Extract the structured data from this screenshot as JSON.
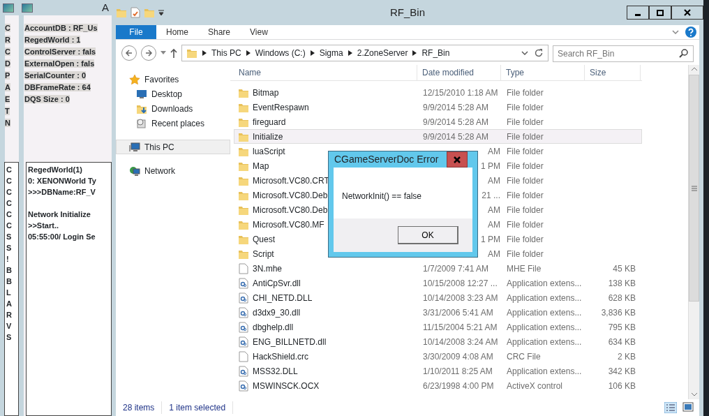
{
  "background_windows": [
    {
      "status_lines": [
        "C",
        "R",
        "C",
        "D",
        "P",
        "A",
        "E",
        "T",
        "N"
      ],
      "log_blocks": [
        [
          "C",
          "C",
          "C",
          "C",
          "C",
          "C",
          "S",
          "S",
          "!",
          "B",
          "B",
          "L",
          "A",
          "R",
          "V",
          "S"
        ]
      ]
    },
    {
      "title": "A",
      "status_lines": [
        "AccountDB : RF_Us",
        "RegedWorld : 1",
        "ControlServer : fals",
        "ExternalOpen : fals",
        "SerialCounter : 0",
        "DBFrameRate : 64",
        "DQS Size : 0"
      ],
      "log_blocks": [
        [
          "RegedWorld(1)",
          "0: XENONWorld Ty",
          ">>>DBName:RF_V"
        ],
        [
          "Network Initialize",
          ">>Start..",
          "05:55:00/ Login Se"
        ]
      ]
    }
  ],
  "explorer": {
    "title": "RF_Bin",
    "ribbon_tabs": [
      {
        "label": "File",
        "selected": true
      },
      {
        "label": "Home",
        "selected": false
      },
      {
        "label": "Share",
        "selected": false
      },
      {
        "label": "View",
        "selected": false
      }
    ],
    "breadcrumbs": [
      "This PC",
      "Windows (C:)",
      "Sigma",
      "2.ZoneServer",
      "RF_Bin"
    ],
    "search": {
      "placeholder": "Search RF_Bin"
    },
    "nav_items": [
      {
        "label": "Favorites",
        "kind": "favorites",
        "selected": false,
        "children": [
          {
            "label": "Desktop",
            "kind": "desktop",
            "selected": false
          },
          {
            "label": "Downloads",
            "kind": "downloads",
            "selected": false
          },
          {
            "label": "Recent places",
            "kind": "recent",
            "selected": false
          }
        ]
      },
      {
        "label": "This PC",
        "kind": "pc",
        "selected": true
      },
      {
        "label": "Network",
        "kind": "network",
        "selected": false
      }
    ],
    "columns": [
      "Name",
      "Date modified",
      "Type",
      "Size"
    ],
    "rows": [
      {
        "name": "Bitmap",
        "date": "12/15/2010 1:18 AM",
        "type": "File folder",
        "kind": "folder",
        "selected": false
      },
      {
        "name": "EventRespawn",
        "date": "9/9/2014 5:28 AM",
        "type": "File folder",
        "kind": "folder",
        "selected": false
      },
      {
        "name": "fireguard",
        "date": "9/9/2014 5:28 AM",
        "type": "File folder",
        "kind": "folder",
        "selected": false
      },
      {
        "name": "Initialize",
        "date": "9/9/2014 5:28 AM",
        "type": "File folder",
        "kind": "folder",
        "selected": true
      },
      {
        "name": "luaScript",
        "date_end": "AM",
        "type": "File folder",
        "kind": "folder"
      },
      {
        "name": "Map",
        "date_end": "1 PM",
        "type": "File folder",
        "kind": "folder"
      },
      {
        "name": "Microsoft.VC80.CRT",
        "date_end": "AM",
        "type": "File folder",
        "kind": "folder"
      },
      {
        "name": "Microsoft.VC80.Deb",
        "date_end": "21 ...",
        "type": "File folder",
        "kind": "folder"
      },
      {
        "name": "Microsoft.VC80.Deb",
        "date_end": "AM",
        "type": "File folder",
        "kind": "folder"
      },
      {
        "name": "Microsoft.VC80.MF",
        "date_end": "AM",
        "type": "File folder",
        "kind": "folder"
      },
      {
        "name": "Quest",
        "date_end": "1 PM",
        "type": "File folder",
        "kind": "folder"
      },
      {
        "name": "Script",
        "date_end": "AM",
        "type": "File folder",
        "kind": "folder"
      },
      {
        "name": "3N.mhe",
        "date": "1/7/2009 7:41 AM",
        "type": "MHE File",
        "size": "45 KB",
        "kind": "file",
        "selected": false
      },
      {
        "name": "AntiCpSvr.dll",
        "date": "10/15/2008 12:27 ...",
        "type": "Application extens...",
        "size": "138 KB",
        "kind": "dll",
        "selected": false
      },
      {
        "name": "CHI_NETD.DLL",
        "date": "10/14/2008 3:23 AM",
        "type": "Application extens...",
        "size": "628 KB",
        "kind": "dll",
        "selected": false
      },
      {
        "name": "d3dx9_30.dll",
        "date": "3/31/2006 5:41 AM",
        "type": "Application extens...",
        "size": "3,836 KB",
        "kind": "dll",
        "selected": false
      },
      {
        "name": "dbghelp.dll",
        "date": "11/15/2004 5:21 AM",
        "type": "Application extens...",
        "size": "795 KB",
        "kind": "dll",
        "selected": false
      },
      {
        "name": "ENG_BILLNETD.dll",
        "date": "10/14/2008 3:24 AM",
        "type": "Application extens...",
        "size": "634 KB",
        "kind": "dll",
        "selected": false
      },
      {
        "name": "HackShield.crc",
        "date": "3/30/2009 4:08 AM",
        "type": "CRC File",
        "size": "2 KB",
        "kind": "file",
        "selected": false
      },
      {
        "name": "MSS32.DLL",
        "date": "1/10/2011 8:25 AM",
        "type": "Application extens...",
        "size": "342 KB",
        "kind": "dll",
        "selected": false
      },
      {
        "name": "MSWINSCK.OCX",
        "date": "6/23/1998 4:00 PM",
        "type": "ActiveX control",
        "size": "106 KB",
        "kind": "dll",
        "selected": false
      }
    ],
    "status_bar": [
      "28 items",
      "1 item selected"
    ]
  },
  "dialog": {
    "title": "CGameServerDoc Error",
    "message": "NetworkInit() == false",
    "button": "OK"
  }
}
